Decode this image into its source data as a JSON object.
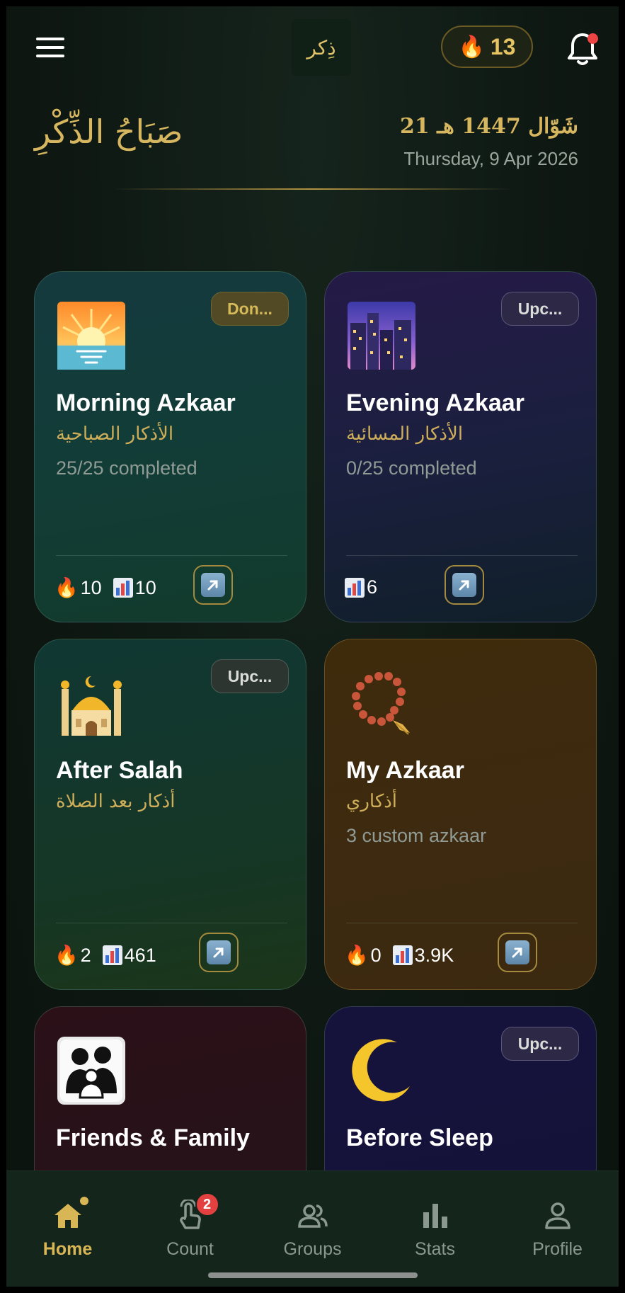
{
  "header": {
    "logo_text": "ذِكر",
    "streak_count": "13",
    "greeting": "صَبَاحُ الذِّكْرِ",
    "hijri_date": "شَوّال 1447 هـ 21",
    "gregorian_date": "Thursday, 9 Apr 2026"
  },
  "cards": [
    {
      "badge": "Don...",
      "title": "Morning Azkaar",
      "arabic": "الأذكار الصباحية",
      "progress": "25/25 completed",
      "streak": "10",
      "count": "10",
      "icon": "sunrise-icon",
      "status": "done"
    },
    {
      "badge": "Upc...",
      "title": "Evening Azkaar",
      "arabic": "الأذكار المسائية",
      "progress": "0/25 completed",
      "streak": "",
      "count": "6",
      "icon": "night-city-icon",
      "status": "upcoming"
    },
    {
      "badge": "Upc...",
      "title": "After Salah",
      "arabic": "أذكار بعد الصلاة",
      "progress": "",
      "streak": "2",
      "count": "461",
      "icon": "mosque-icon",
      "status": "upcoming"
    },
    {
      "badge": "",
      "title": "My Azkaar",
      "arabic": "أذكاري",
      "progress": "3 custom azkaar",
      "streak": "0",
      "count": "3.9K",
      "icon": "prayer-beads-icon",
      "status": "none"
    },
    {
      "badge": "",
      "title": "Friends & Family",
      "arabic": "",
      "progress": "",
      "streak": "",
      "count": "",
      "icon": "family-icon",
      "status": "none"
    },
    {
      "badge": "Upc...",
      "title": "Before Sleep",
      "arabic": "",
      "progress": "",
      "streak": "",
      "count": "",
      "icon": "crescent-moon-icon",
      "status": "upcoming"
    }
  ],
  "nav": [
    {
      "label": "Home",
      "icon": "home-icon",
      "active": true
    },
    {
      "label": "Count",
      "icon": "tap-icon",
      "badge": "2"
    },
    {
      "label": "Groups",
      "icon": "groups-icon"
    },
    {
      "label": "Stats",
      "icon": "stats-icon"
    },
    {
      "label": "Profile",
      "icon": "profile-icon"
    }
  ],
  "colors": {
    "accent_gold": "#d8b655",
    "background": "#0e1712",
    "notification_red": "#ef4444"
  }
}
